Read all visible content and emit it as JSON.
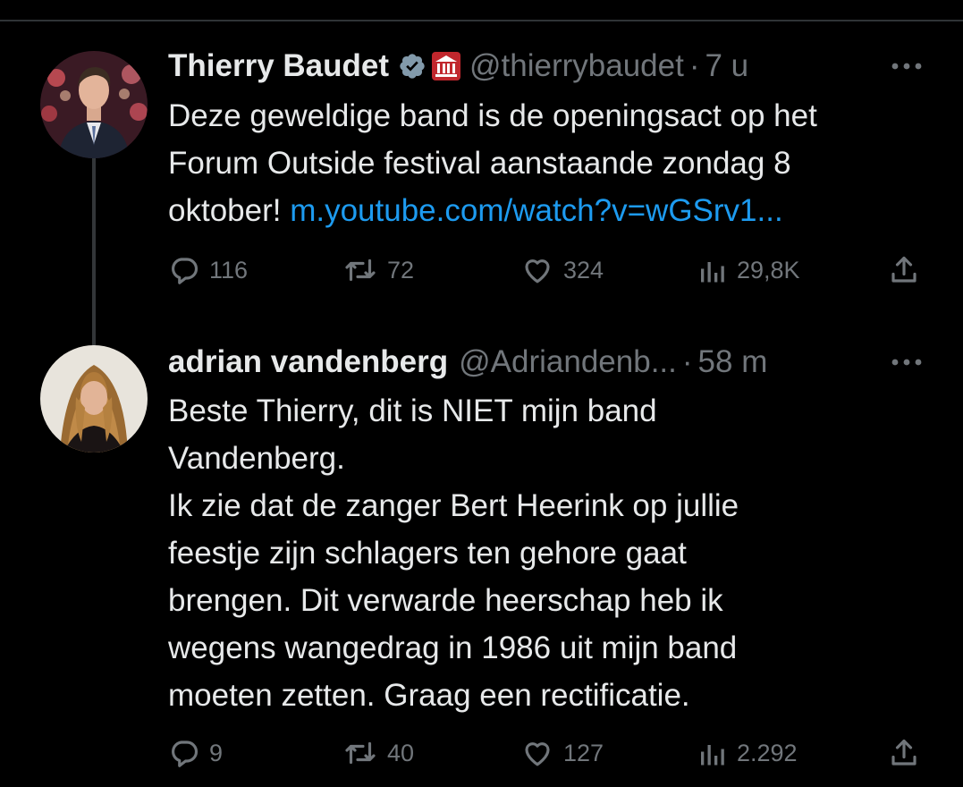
{
  "tweets": [
    {
      "name": "Thierry Baudet",
      "handle": "@thierrybaudet",
      "separator": "·",
      "time": "7 u",
      "verified": true,
      "government_badge": true,
      "text_lines": [
        "Deze geweldige band is de openingsact op het",
        "Forum Outside festival aanstaande zondag 8",
        "oktober!"
      ],
      "link_text": "m.youtube.com/watch?v=wGSrv1...",
      "replies": "116",
      "reposts": "72",
      "likes": "324",
      "views": "29,8K"
    },
    {
      "name": "adrian vandenberg",
      "handle": "@Adriandenb...",
      "separator": "·",
      "time": "58 m",
      "text_lines": [
        "Beste Thierry, dit is NIET mijn band",
        "Vandenberg.",
        "Ik zie dat de zanger Bert Heerink op jullie",
        "feestje zijn schlagers ten gehore gaat",
        "brengen. Dit verwarde heerschap heb ik",
        "wegens wangedrag in 1986 uit mijn band",
        "moeten zetten. Graag een rectificatie."
      ],
      "replies": "9",
      "reposts": "40",
      "likes": "127",
      "views": "2.292"
    }
  ],
  "colors": {
    "background": "#000000",
    "text": "#e7e9ea",
    "muted": "#71767b",
    "link": "#1d9bf0",
    "verified_badge": "#829aab",
    "government_badge": "#c1272d",
    "thread_line": "#333639"
  },
  "icons": {
    "reply": "reply-icon",
    "repost": "repost-icon",
    "like": "heart-icon",
    "views": "views-icon",
    "share": "share-icon",
    "more": "more-icon",
    "verified": "verified-badge-icon",
    "government": "government-badge-icon"
  }
}
